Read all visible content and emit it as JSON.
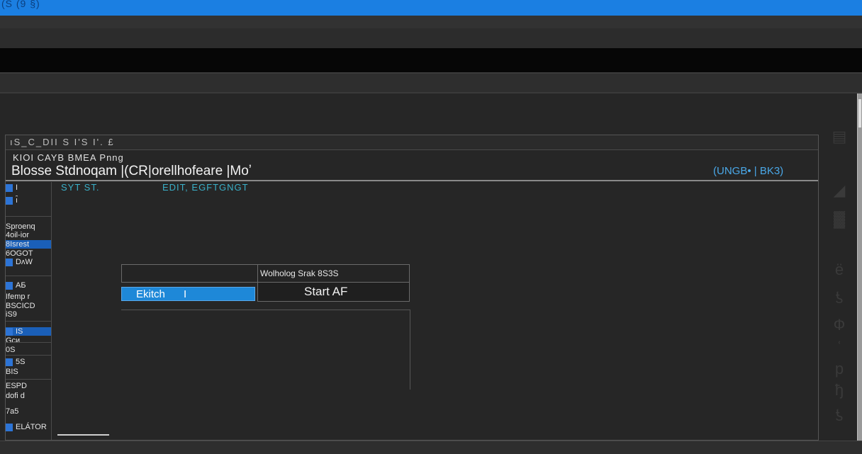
{
  "window": {
    "title": "(S (9 §)"
  },
  "main_window": {
    "header_text": "ıS_C_DII S I'S I'. £",
    "caption_small": "KIOI CAYB BMEA Pnng",
    "caption_large": "Blosse Stdnoqam |(CR|orellhofeare |Moʼ",
    "caption_right": "(UNGB• |  BK3)"
  },
  "sidebar": {
    "items": [
      {
        "label": "I"
      },
      {
        "label": "ı̑"
      },
      {
        "label": "Sproenq"
      },
      {
        "label": "4oil-ior"
      },
      {
        "label": "8Isrest"
      },
      {
        "label": "6OGOT"
      },
      {
        "label": "DʌW"
      },
      {
        "label": "AБ"
      },
      {
        "label": "Ifemp r"
      },
      {
        "label": "BSCIСD"
      },
      {
        "label": "іS9"
      },
      {
        "label": "IS"
      },
      {
        "label": "Gси"
      },
      {
        "label": "0S"
      },
      {
        "label": "5S"
      },
      {
        "label": "BIS"
      },
      {
        "label": "ESPD"
      },
      {
        "label": "dofi d"
      },
      {
        "label": "7а5"
      },
      {
        "label": "ELÁTOR"
      }
    ]
  },
  "toolbar": {
    "left_text": "SYT ST.",
    "right_text": "EDIT, EGFTGNGT"
  },
  "dialog": {
    "status_text": "Wolholog Srak 8S3S",
    "exit_label": "Ekitch",
    "exit_cursor": "I",
    "start_label": "Start AF"
  },
  "right_panel": {
    "glyphs": [
      "▤",
      "◢",
      "▓",
      "ё",
      "ƾ",
      "Ф",
      "ʿ",
      "р",
      "ђ",
      "ƾ"
    ]
  }
}
